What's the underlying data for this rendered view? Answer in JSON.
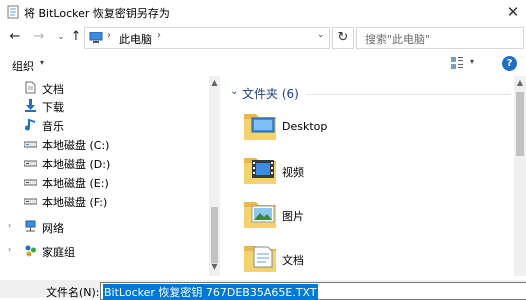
{
  "window": {
    "title": "将 BitLocker 恢复密钥另存为",
    "close_glyph": "✕"
  },
  "nav": {
    "back_glyph": "←",
    "forward_glyph": "→",
    "recent_glyph": "⌄",
    "up_glyph": "↑",
    "address": {
      "separator": "›",
      "location": "此电脑",
      "dropdown_glyph": "⌄"
    },
    "refresh_glyph": "↻",
    "search_placeholder": "搜索\"此电脑\""
  },
  "toolbar": {
    "organize_label": "组织",
    "dropdown_glyph": "▾",
    "help_glyph": "?"
  },
  "sidebar": {
    "items": [
      {
        "label": "文档",
        "icon": "document-icon"
      },
      {
        "label": "下载",
        "icon": "download-icon"
      },
      {
        "label": "音乐",
        "icon": "music-icon"
      },
      {
        "label": "本地磁盘 (C:)",
        "icon": "drive-icon"
      },
      {
        "label": "本地磁盘 (D:)",
        "icon": "drive-icon"
      },
      {
        "label": "本地磁盘 (E:)",
        "icon": "drive-icon"
      },
      {
        "label": "本地磁盘 (F:)",
        "icon": "drive-icon"
      },
      {
        "label": "网络",
        "icon": "network-icon"
      },
      {
        "label": "家庭组",
        "icon": "homegroup-icon"
      }
    ],
    "expander_glyph": "›"
  },
  "content": {
    "group_chevron": "⌄",
    "group_title": "文件夹 (6)",
    "folders": [
      {
        "label": "Desktop",
        "icon": "desktop-folder-icon"
      },
      {
        "label": "视频",
        "icon": "videos-folder-icon"
      },
      {
        "label": "图片",
        "icon": "pictures-folder-icon"
      },
      {
        "label": "文档",
        "icon": "documents-folder-icon"
      }
    ]
  },
  "scroll_glyphs": {
    "up": "▲",
    "down": "▼"
  },
  "save_form": {
    "filename_label": "文件名(N):",
    "filename_value": "BitLocker 恢复密钥 767DEB35A65E.TXT"
  },
  "colors": {
    "accent": "#0078d7",
    "folder": "#f2c44b",
    "group_title": "#1e3f8a"
  }
}
